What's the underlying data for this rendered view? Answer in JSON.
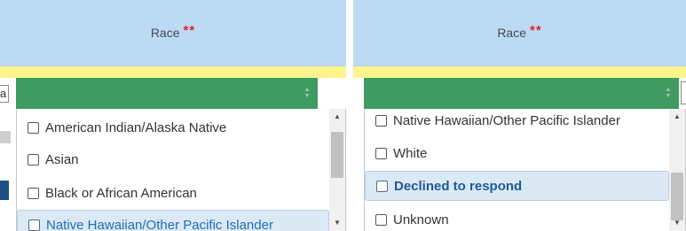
{
  "left_panel": {
    "header": {
      "label": "Race",
      "required_mark": "**"
    },
    "left_cut_text": "a",
    "select": {
      "value": "",
      "caret_icon": "sort-caret"
    },
    "options": [
      {
        "label": "American Indian/Alaska Native",
        "checked": false,
        "highlighted": false
      },
      {
        "label": "Asian",
        "checked": false,
        "highlighted": false
      },
      {
        "label": "Black or African American",
        "checked": false,
        "highlighted": false
      },
      {
        "label": "Native Hawaiian/Other Pacific Islander",
        "checked": false,
        "highlighted": true
      }
    ]
  },
  "right_panel": {
    "header": {
      "label": "Race",
      "required_mark": "**"
    },
    "select": {
      "value": "",
      "caret_icon": "sort-caret"
    },
    "options": [
      {
        "label": "Native Hawaiian/Other Pacific Islander",
        "checked": false,
        "highlighted": false
      },
      {
        "label": "White",
        "checked": false,
        "highlighted": false
      },
      {
        "label": "Declined to respond",
        "checked": false,
        "highlighted": true
      },
      {
        "label": "Unknown",
        "checked": false,
        "highlighted": false
      }
    ]
  },
  "colors": {
    "header_bg": "#bcdaf4",
    "required": "#e0232b",
    "select_bg": "#3f9b62",
    "band": "#fdf58b",
    "highlight_bg": "#dbe9f5"
  }
}
